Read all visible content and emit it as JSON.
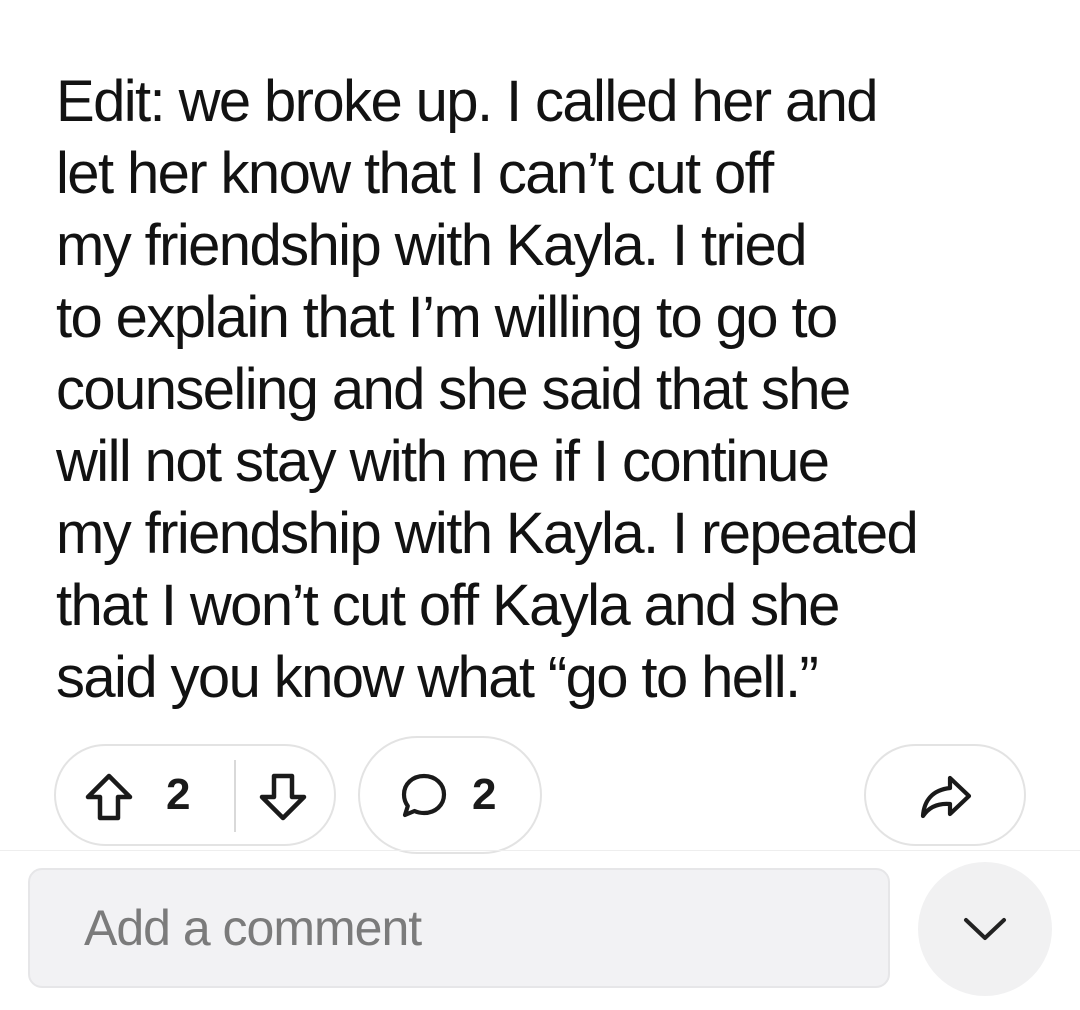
{
  "post": {
    "lines": [
      "Edit: we broke up. I called her and",
      "let her know that I can’t cut off",
      "my friendship with Kayla. I tried",
      "to explain that I’m willing to go to",
      "counseling and she said that she",
      "will not stay with me if I continue",
      "my friendship with Kayla. I repeated",
      "that I won’t cut off Kayla and she",
      "said you know what “go to hell.”"
    ]
  },
  "actions": {
    "vote_count": "2",
    "comment_count": "2",
    "upvote_icon": "upvote-arrow-icon",
    "downvote_icon": "downvote-arrow-icon",
    "comment_icon": "speech-bubble-icon",
    "share_icon": "share-arrow-icon"
  },
  "comment_box": {
    "placeholder": "Add a comment"
  },
  "collapse": {
    "icon": "chevron-down-icon"
  },
  "colors": {
    "text": "#121212",
    "pill_border": "#e3e3e3",
    "input_bg": "#f2f2f4",
    "placeholder": "#7b7b7b"
  }
}
